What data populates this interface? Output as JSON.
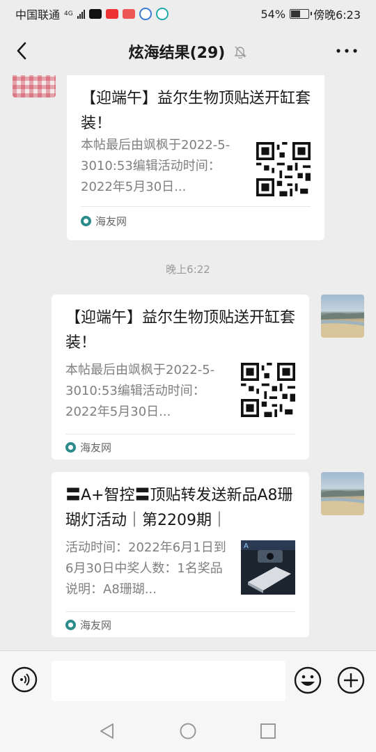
{
  "status_bar": {
    "carrier": "中国联通",
    "network": "4G",
    "battery": "54%",
    "battery_level": 0.54,
    "time": "傍晚6:23"
  },
  "header": {
    "title": "炫海结果(29)"
  },
  "messages": [
    {
      "sender": "other",
      "title": "【迎端午】益尔生物顶贴送开缸套装！",
      "desc": "本帖最后由飒枫于2022-5-3010:53编辑活动时间：2022年5月30日...",
      "source": "海友网"
    },
    {
      "sender": "self",
      "title": "【迎端午】益尔生物顶贴送开缸套装！",
      "desc": "本帖最后由飒枫于2022-5-3010:53编辑活动时间：2022年5月30日...",
      "source": "海友网"
    },
    {
      "sender": "self",
      "title": "〓A+智控〓顶贴转发送新品A8珊 瑚灯活动｜第2209期｜",
      "desc": "活动时间：2022年6月1日到6月30日中奖人数：1名奖品说明：A8珊瑚...",
      "source": "海友网"
    }
  ],
  "time_separator": "晚上6:22",
  "icons": {
    "back": "chevron-left-icon",
    "mute": "bell-off-icon",
    "more": "more-horizontal-icon",
    "voice": "voice-input-icon",
    "emoji": "emoji-icon",
    "plus": "plus-circle-icon"
  }
}
